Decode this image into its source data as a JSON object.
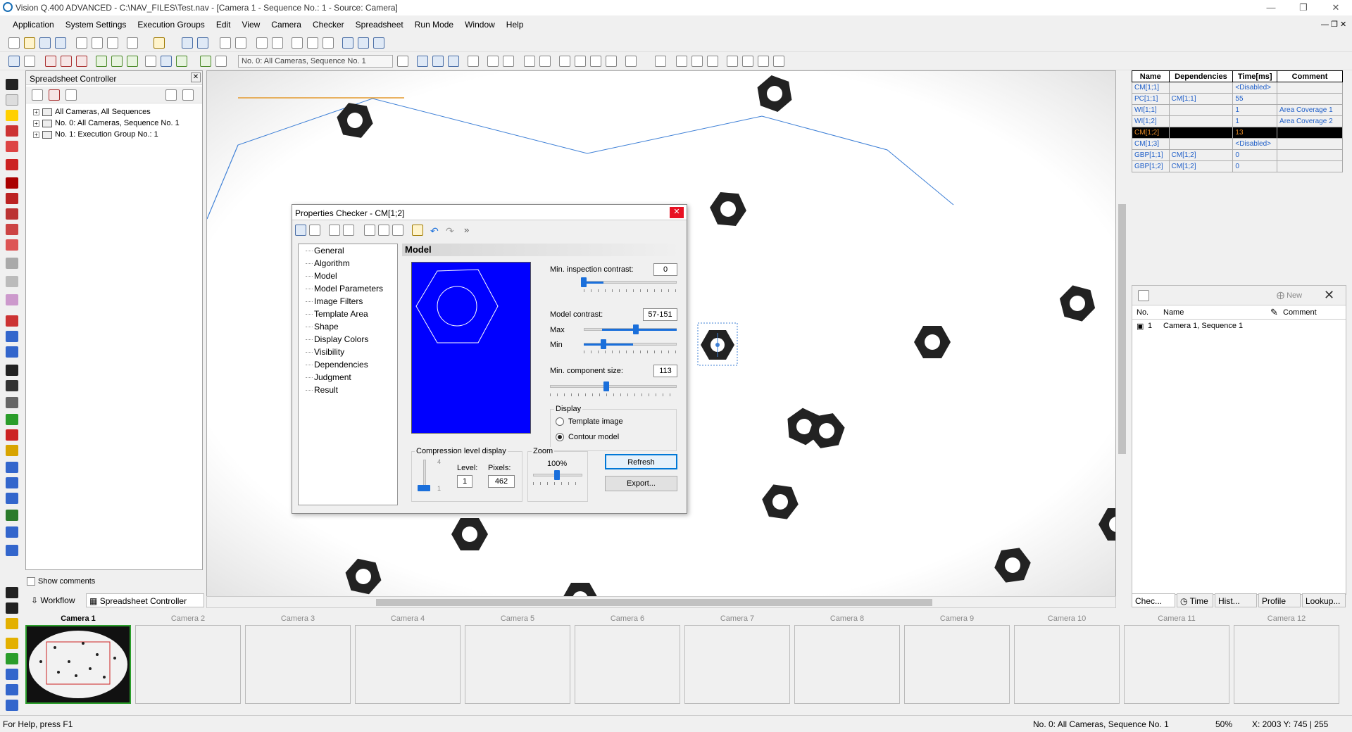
{
  "window": {
    "title": "Vision Q.400 ADVANCED - C:\\NAV_FILES\\Test.nav - [Camera  1 - Sequence No.: 1 - Source: Camera]"
  },
  "menu": [
    "Application",
    "System Settings",
    "Execution Groups",
    "Edit",
    "View",
    "Camera",
    "Checker",
    "Spreadsheet",
    "Run Mode",
    "Window",
    "Help"
  ],
  "toolbar": {
    "sequence_select": "No. 0: All Cameras, Sequence No. 1"
  },
  "spreadsheet_controller": {
    "title": "Spreadsheet Controller",
    "tree": [
      "All Cameras, All Sequences",
      "No.  0: All Cameras, Sequence No. 1",
      "No.  1: Execution Group No.:  1"
    ],
    "show_comments": "Show comments",
    "tabs": [
      "Workflow",
      "Spreadsheet Controller"
    ]
  },
  "checker_table": {
    "headers": [
      "Name",
      "Dependencies",
      "Time[ms]",
      "Comment"
    ],
    "rows": [
      [
        "CM[1;1]",
        "",
        "<Disabled>",
        ""
      ],
      [
        "PC[1;1]",
        "CM[1;1]",
        "55",
        ""
      ],
      [
        "WI[1;1]",
        "",
        "1",
        "Area Coverage 1"
      ],
      [
        "WI[1;2]",
        "",
        "1",
        "Area Coverage 2"
      ],
      [
        "CM[1;2]",
        "",
        "13",
        ""
      ],
      [
        "CM[1;3]",
        "",
        "<Disabled>",
        ""
      ],
      [
        "GBP[1;1]",
        "CM[1;2]",
        "0",
        ""
      ],
      [
        "GBP[1;2]",
        "CM[1;2]",
        "0",
        ""
      ]
    ],
    "selected_index": 4
  },
  "sequence_panel": {
    "new_label": "New",
    "headers": [
      "No.",
      "Name",
      "Comment"
    ],
    "rows": [
      [
        "1",
        "Camera  1, Sequence  1"
      ]
    ]
  },
  "right_tabs": [
    "Chec...",
    "Time",
    "Hist...",
    "Profile",
    "Lookup..."
  ],
  "dialog": {
    "title": "Properties Checker - CM[1;2]",
    "nav": [
      "General",
      "Algorithm",
      "Model",
      "Model Parameters",
      "Image Filters",
      "Template Area",
      "Shape",
      "Display Colors",
      "Visibility",
      "Dependencies",
      "Judgment",
      "Result"
    ],
    "section_title": "Model",
    "min_inspection_contrast_label": "Min. inspection contrast:",
    "min_inspection_contrast": "0",
    "model_contrast_label": "Model contrast:",
    "model_contrast": "57-151",
    "max_label": "Max",
    "min_label": "Min",
    "min_component_size_label": "Min. component size:",
    "min_component_size": "113",
    "display_label": "Display",
    "template_image_label": "Template image",
    "contour_model_label": "Contour model",
    "display_selected": "Contour model",
    "compression_label": "Compression level display",
    "compression_tick_high": "4",
    "compression_tick_low": "1",
    "level_label": "Level:",
    "level": "1",
    "pixels_label": "Pixels:",
    "pixels": "462",
    "zoom_label": "Zoom",
    "zoom_value": "100%",
    "refresh_button": "Refresh",
    "export_button": "Export..."
  },
  "cameras": [
    "Camera  1",
    "Camera  2",
    "Camera  3",
    "Camera  4",
    "Camera  5",
    "Camera  6",
    "Camera  7",
    "Camera  8",
    "Camera  9",
    "Camera 10",
    "Camera 11",
    "Camera 12"
  ],
  "active_camera": "Camera  1",
  "status": {
    "help": "For Help, press F1",
    "sequence": "No. 0: All Cameras, Sequence No. 1",
    "zoom": "50%",
    "coords": "X: 2003  Y: 745 | 255"
  },
  "colors": {
    "accent": "#0078d7",
    "model_bg": "#0000ff",
    "selected_row_text": "#e58a26",
    "link_text": "#1e5ec8"
  }
}
